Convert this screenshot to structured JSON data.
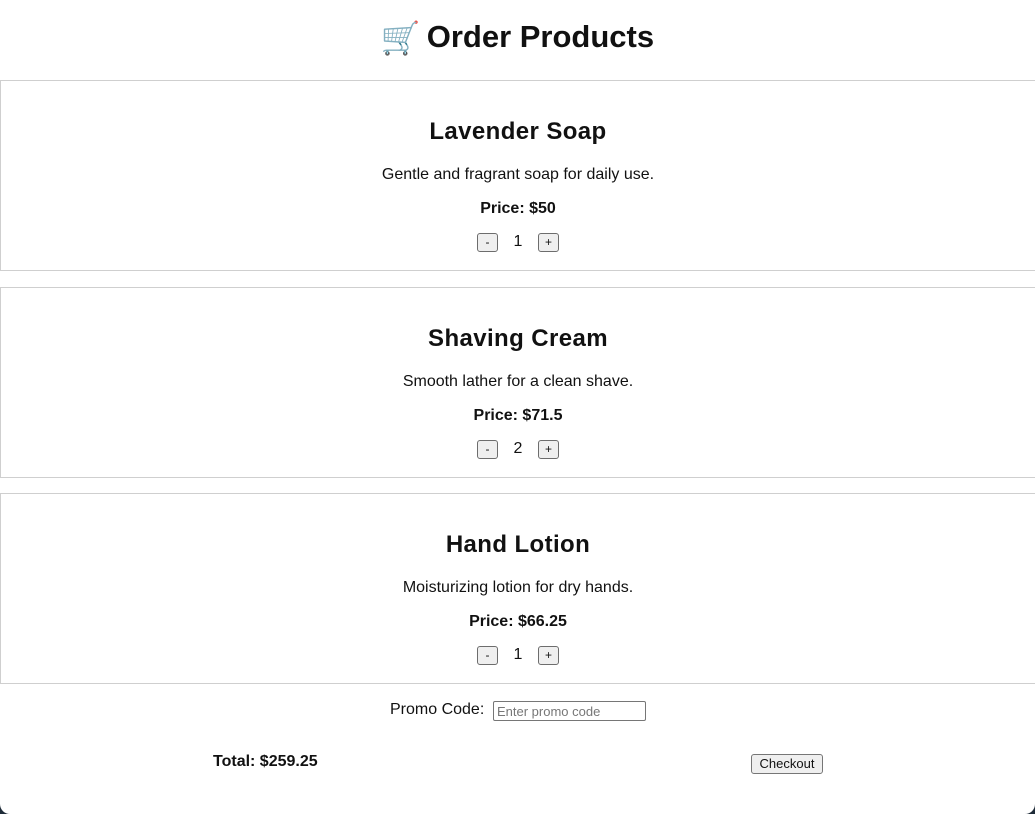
{
  "header": {
    "icon": "shopping-cart-icon",
    "icon_glyph": "🛒",
    "title": "Order Products"
  },
  "products": [
    {
      "name": "Lavender Soap",
      "description": "Gentle and fragrant soap for daily use.",
      "price_label": "Price: $50",
      "quantity": "1",
      "decrement_label": "-",
      "increment_label": "+"
    },
    {
      "name": "Shaving Cream",
      "description": "Smooth lather for a clean shave.",
      "price_label": "Price: $71.5",
      "quantity": "2",
      "decrement_label": "-",
      "increment_label": "+"
    },
    {
      "name": "Hand Lotion",
      "description": "Moisturizing lotion for dry hands.",
      "price_label": "Price: $66.25",
      "quantity": "1",
      "decrement_label": "-",
      "increment_label": "+"
    }
  ],
  "promo": {
    "label": "Promo Code:",
    "placeholder": "Enter promo code",
    "value": ""
  },
  "summary": {
    "total_label": "Total: $259.25",
    "checkout_label": "Checkout"
  },
  "colors": {
    "page_background": "#ffffff",
    "outer_background": "#1e2b38",
    "card_border": "#cfcfcf",
    "button_background": "#efefef"
  }
}
